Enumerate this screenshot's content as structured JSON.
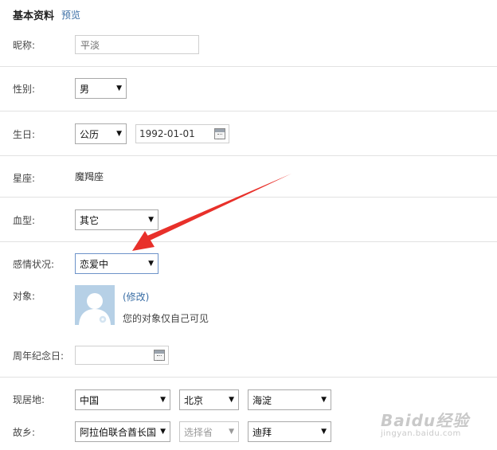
{
  "header": {
    "title": "基本资料",
    "preview_link": "预览"
  },
  "nickname": {
    "label": "昵称:",
    "value": "平淡"
  },
  "gender": {
    "label": "性别:",
    "selected": "男"
  },
  "birthday": {
    "label": "生日:",
    "calendar_type": "公历",
    "date": "1992-01-01"
  },
  "zodiac": {
    "label": "星座:",
    "value": "魔羯座"
  },
  "blood_type": {
    "label": "血型:",
    "selected": "其它"
  },
  "relationship": {
    "label": "感情状况:",
    "selected": "恋爱中"
  },
  "partner": {
    "label": "对象:",
    "modify_link": "(修改)",
    "note": "您的对象仅自己可见"
  },
  "anniversary": {
    "label": "周年纪念日:",
    "date": ""
  },
  "residence": {
    "label": "现居地:",
    "country": "中国",
    "province": "北京",
    "city": "海淀"
  },
  "hometown": {
    "label": "故乡:",
    "country": "阿拉伯联合酋长国",
    "province": "选择省",
    "city": "迪拜"
  },
  "watermark": {
    "main": "Baidu经验",
    "sub": "jingyan.baidu.com"
  },
  "colors": {
    "link": "#3a6ea5",
    "arrow": "#e8302a",
    "divider": "#e2e2e2",
    "focus_border": "#6d93c9"
  },
  "icons": {
    "calendar": "calendar-icon",
    "dropdown": "caret-down-icon",
    "avatar": "default-avatar-icon"
  }
}
